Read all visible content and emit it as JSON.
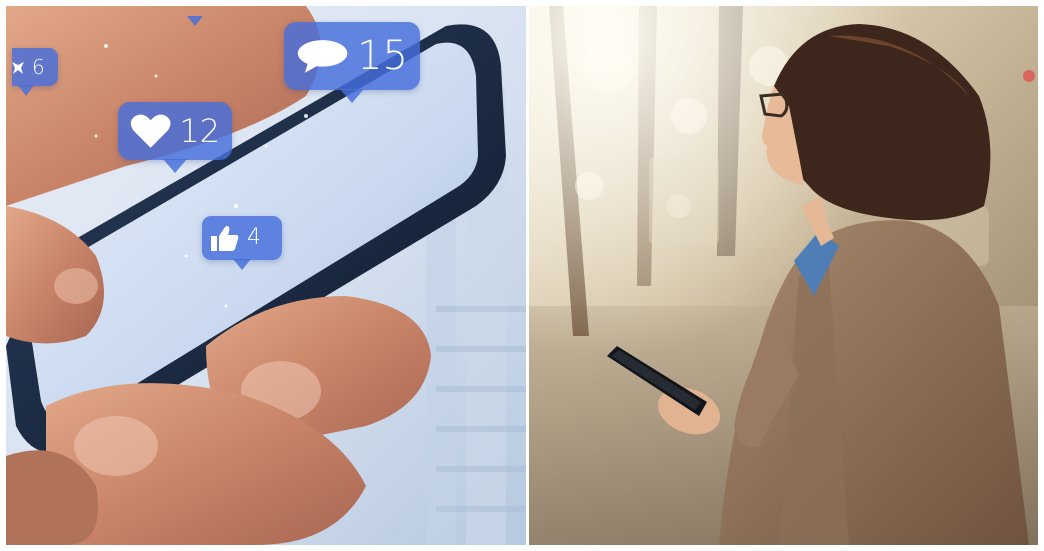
{
  "reactions": {
    "comment": {
      "icon": "speech-bubble-icon",
      "count": "15"
    },
    "heart": {
      "icon": "heart-icon",
      "count": "12"
    },
    "like": {
      "icon": "thumbs-up-icon",
      "count": "4"
    },
    "star": {
      "icon": "star-icon",
      "count": "6"
    }
  },
  "colors": {
    "bubble": "#466edc",
    "left_background": "#dce6f4",
    "right_background": "#c7b08f",
    "coat": "#8a6a52",
    "hair": "#3d261c"
  }
}
